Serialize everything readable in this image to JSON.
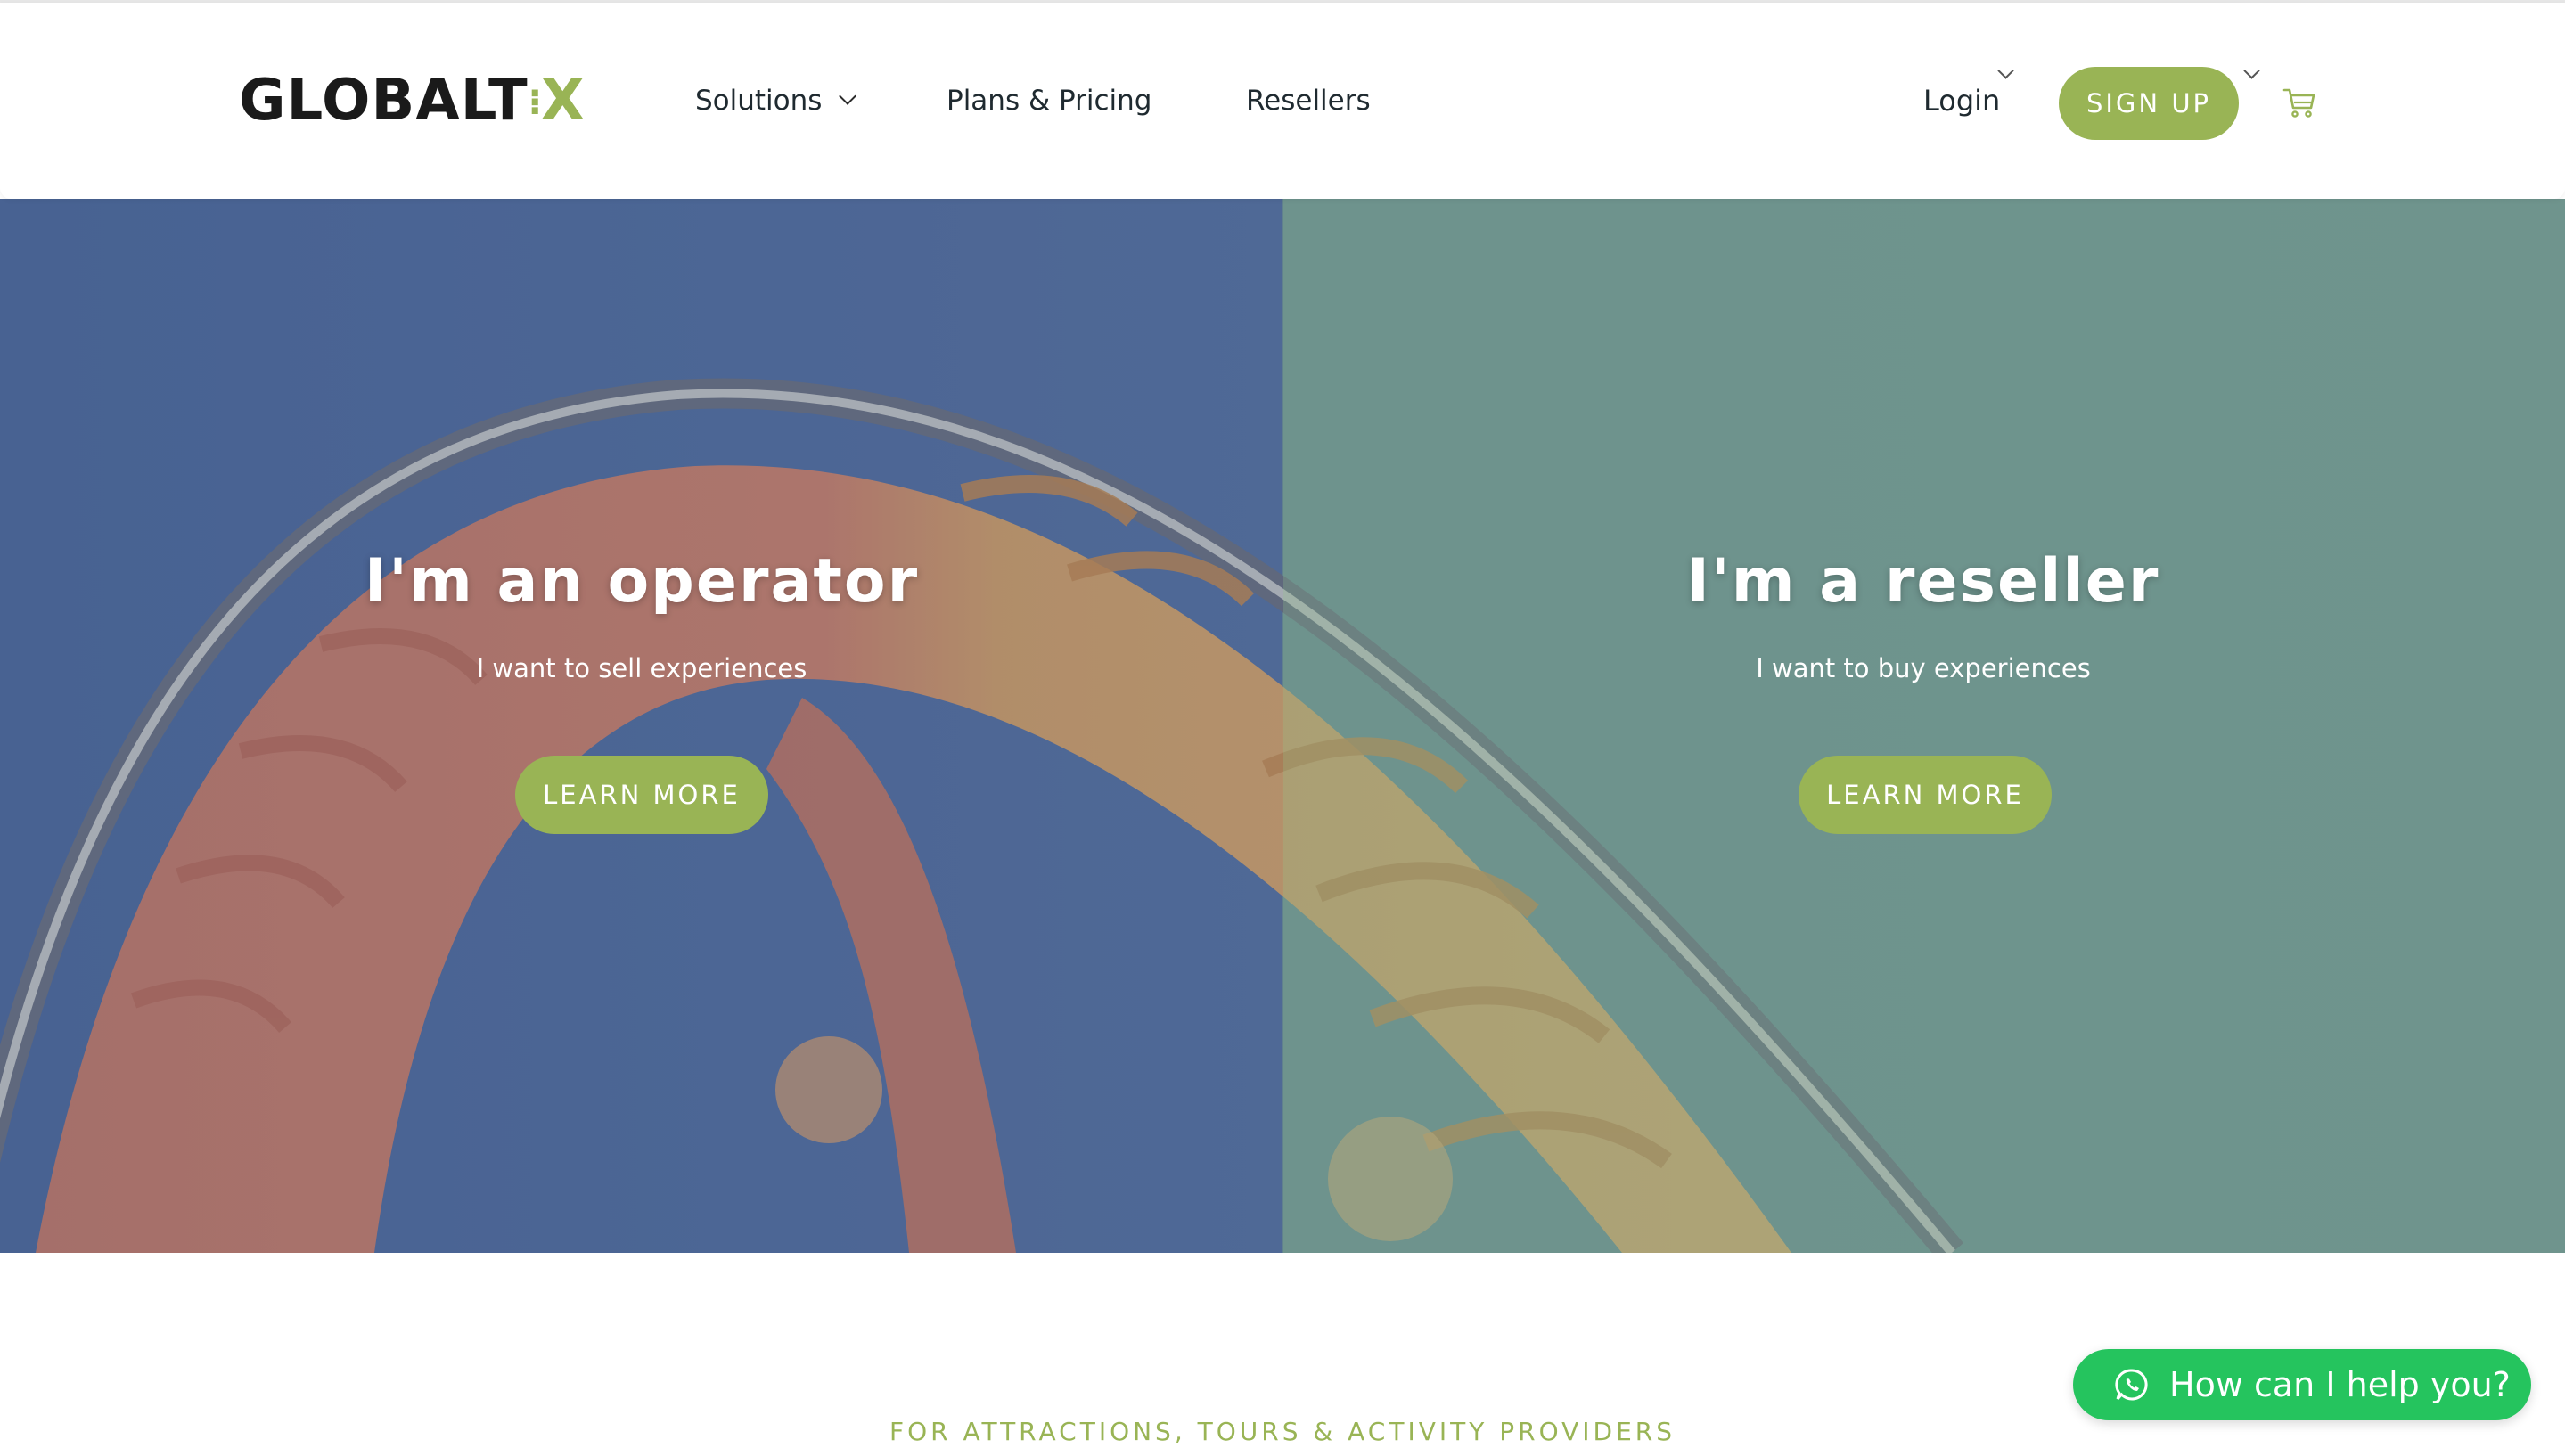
{
  "header": {
    "logo_main": "GLOBALT",
    "logo_accent": "X",
    "nav": [
      {
        "label": "Solutions",
        "has_dropdown": true
      },
      {
        "label": "Plans & Pricing"
      },
      {
        "label": "Resellers"
      }
    ],
    "login_label": "Login",
    "signup_label": "SIGN UP",
    "cart_icon": "cart-icon"
  },
  "hero": {
    "operator": {
      "title": "I'm an operator",
      "subtitle": "I want to sell experiences",
      "button": "LEARN MORE"
    },
    "reseller": {
      "title": "I'm a reseller",
      "subtitle": "I want to buy experiences",
      "button": "LEARN MORE"
    }
  },
  "section": {
    "caption": "FOR ATTRACTIONS, TOURS & ACTIVITY PROVIDERS"
  },
  "chat": {
    "label": "How can I help you?",
    "icon": "whatsapp-icon"
  },
  "colors": {
    "accent": "#99b455",
    "chat_green": "#25c45e",
    "text_dark": "#1f2a30"
  }
}
